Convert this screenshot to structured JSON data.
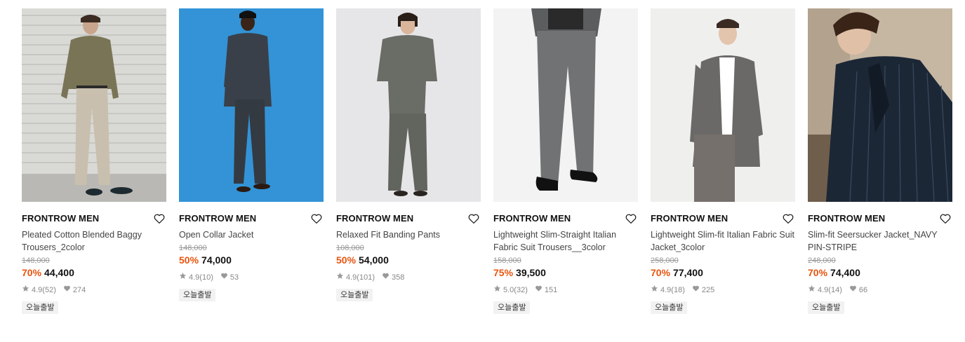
{
  "products": [
    {
      "brand": "FRONTROW MEN",
      "name": "Pleated Cotton Blended Baggy Trousers_2color",
      "original_price": "148,000",
      "discount": "70%",
      "price": "44,400",
      "rating": "4.9",
      "reviews": "(52)",
      "likes": "274",
      "badge": "오늘출발",
      "image": "model-beige-trousers"
    },
    {
      "brand": "FRONTROW MEN",
      "name": "Open Collar Jacket",
      "original_price": "148,000",
      "discount": "50%",
      "price": "74,000",
      "rating": "4.9",
      "reviews": "(10)",
      "likes": "53",
      "badge": "오늘출발",
      "image": "model-blue-backdrop"
    },
    {
      "brand": "FRONTROW MEN",
      "name": "Relaxed Fit Banding Pants",
      "original_price": "108,000",
      "discount": "50%",
      "price": "54,000",
      "rating": "4.9",
      "reviews": "(101)",
      "likes": "358",
      "badge": "오늘출발",
      "image": "model-grey-set"
    },
    {
      "brand": "FRONTROW MEN",
      "name": "Lightweight Slim-Straight Italian Fabric Suit Trousers__3color",
      "original_price": "158,000",
      "discount": "75%",
      "price": "39,500",
      "rating": "5.0",
      "reviews": "(32)",
      "likes": "151",
      "badge": "오늘출발",
      "image": "model-suit-trousers"
    },
    {
      "brand": "FRONTROW MEN",
      "name": "Lightweight Slim-fit Italian Fabric Suit Jacket_3color",
      "original_price": "258,000",
      "discount": "70%",
      "price": "77,400",
      "rating": "4.9",
      "reviews": "(18)",
      "likes": "225",
      "badge": "오늘출발",
      "image": "model-suit-jacket"
    },
    {
      "brand": "FRONTROW MEN",
      "name": "Slim-fit Seersucker Jacket_NAVY PIN-STRIPE",
      "original_price": "248,000",
      "discount": "70%",
      "price": "74,400",
      "rating": "4.9",
      "reviews": "(14)",
      "likes": "66",
      "badge": "오늘출발",
      "image": "model-navy-stripe"
    }
  ],
  "icons": {
    "wishlist": "heart-outline-icon",
    "rating": "star-icon",
    "likes": "heart-filled-icon"
  },
  "colors": {
    "discount": "#e8540f",
    "text": "#111111",
    "muted": "#888888"
  }
}
